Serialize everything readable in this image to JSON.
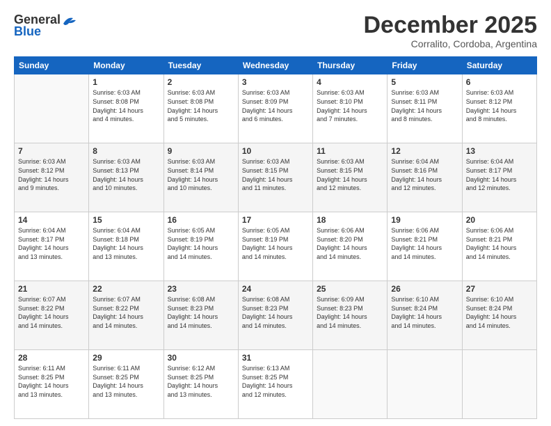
{
  "header": {
    "logo_general": "General",
    "logo_blue": "Blue",
    "month": "December 2025",
    "location": "Corralito, Cordoba, Argentina"
  },
  "weekdays": [
    "Sunday",
    "Monday",
    "Tuesday",
    "Wednesday",
    "Thursday",
    "Friday",
    "Saturday"
  ],
  "weeks": [
    [
      {
        "day": "",
        "sunrise": "",
        "sunset": "",
        "daylight": ""
      },
      {
        "day": "1",
        "sunrise": "Sunrise: 6:03 AM",
        "sunset": "Sunset: 8:08 PM",
        "daylight": "Daylight: 14 hours and 4 minutes."
      },
      {
        "day": "2",
        "sunrise": "Sunrise: 6:03 AM",
        "sunset": "Sunset: 8:08 PM",
        "daylight": "Daylight: 14 hours and 5 minutes."
      },
      {
        "day": "3",
        "sunrise": "Sunrise: 6:03 AM",
        "sunset": "Sunset: 8:09 PM",
        "daylight": "Daylight: 14 hours and 6 minutes."
      },
      {
        "day": "4",
        "sunrise": "Sunrise: 6:03 AM",
        "sunset": "Sunset: 8:10 PM",
        "daylight": "Daylight: 14 hours and 7 minutes."
      },
      {
        "day": "5",
        "sunrise": "Sunrise: 6:03 AM",
        "sunset": "Sunset: 8:11 PM",
        "daylight": "Daylight: 14 hours and 8 minutes."
      },
      {
        "day": "6",
        "sunrise": "Sunrise: 6:03 AM",
        "sunset": "Sunset: 8:12 PM",
        "daylight": "Daylight: 14 hours and 8 minutes."
      }
    ],
    [
      {
        "day": "7",
        "sunrise": "Sunrise: 6:03 AM",
        "sunset": "Sunset: 8:12 PM",
        "daylight": "Daylight: 14 hours and 9 minutes."
      },
      {
        "day": "8",
        "sunrise": "Sunrise: 6:03 AM",
        "sunset": "Sunset: 8:13 PM",
        "daylight": "Daylight: 14 hours and 10 minutes."
      },
      {
        "day": "9",
        "sunrise": "Sunrise: 6:03 AM",
        "sunset": "Sunset: 8:14 PM",
        "daylight": "Daylight: 14 hours and 10 minutes."
      },
      {
        "day": "10",
        "sunrise": "Sunrise: 6:03 AM",
        "sunset": "Sunset: 8:15 PM",
        "daylight": "Daylight: 14 hours and 11 minutes."
      },
      {
        "day": "11",
        "sunrise": "Sunrise: 6:03 AM",
        "sunset": "Sunset: 8:15 PM",
        "daylight": "Daylight: 14 hours and 12 minutes."
      },
      {
        "day": "12",
        "sunrise": "Sunrise: 6:04 AM",
        "sunset": "Sunset: 8:16 PM",
        "daylight": "Daylight: 14 hours and 12 minutes."
      },
      {
        "day": "13",
        "sunrise": "Sunrise: 6:04 AM",
        "sunset": "Sunset: 8:17 PM",
        "daylight": "Daylight: 14 hours and 12 minutes."
      }
    ],
    [
      {
        "day": "14",
        "sunrise": "Sunrise: 6:04 AM",
        "sunset": "Sunset: 8:17 PM",
        "daylight": "Daylight: 14 hours and 13 minutes."
      },
      {
        "day": "15",
        "sunrise": "Sunrise: 6:04 AM",
        "sunset": "Sunset: 8:18 PM",
        "daylight": "Daylight: 14 hours and 13 minutes."
      },
      {
        "day": "16",
        "sunrise": "Sunrise: 6:05 AM",
        "sunset": "Sunset: 8:19 PM",
        "daylight": "Daylight: 14 hours and 14 minutes."
      },
      {
        "day": "17",
        "sunrise": "Sunrise: 6:05 AM",
        "sunset": "Sunset: 8:19 PM",
        "daylight": "Daylight: 14 hours and 14 minutes."
      },
      {
        "day": "18",
        "sunrise": "Sunrise: 6:06 AM",
        "sunset": "Sunset: 8:20 PM",
        "daylight": "Daylight: 14 hours and 14 minutes."
      },
      {
        "day": "19",
        "sunrise": "Sunrise: 6:06 AM",
        "sunset": "Sunset: 8:21 PM",
        "daylight": "Daylight: 14 hours and 14 minutes."
      },
      {
        "day": "20",
        "sunrise": "Sunrise: 6:06 AM",
        "sunset": "Sunset: 8:21 PM",
        "daylight": "Daylight: 14 hours and 14 minutes."
      }
    ],
    [
      {
        "day": "21",
        "sunrise": "Sunrise: 6:07 AM",
        "sunset": "Sunset: 8:22 PM",
        "daylight": "Daylight: 14 hours and 14 minutes."
      },
      {
        "day": "22",
        "sunrise": "Sunrise: 6:07 AM",
        "sunset": "Sunset: 8:22 PM",
        "daylight": "Daylight: 14 hours and 14 minutes."
      },
      {
        "day": "23",
        "sunrise": "Sunrise: 6:08 AM",
        "sunset": "Sunset: 8:23 PM",
        "daylight": "Daylight: 14 hours and 14 minutes."
      },
      {
        "day": "24",
        "sunrise": "Sunrise: 6:08 AM",
        "sunset": "Sunset: 8:23 PM",
        "daylight": "Daylight: 14 hours and 14 minutes."
      },
      {
        "day": "25",
        "sunrise": "Sunrise: 6:09 AM",
        "sunset": "Sunset: 8:23 PM",
        "daylight": "Daylight: 14 hours and 14 minutes."
      },
      {
        "day": "26",
        "sunrise": "Sunrise: 6:10 AM",
        "sunset": "Sunset: 8:24 PM",
        "daylight": "Daylight: 14 hours and 14 minutes."
      },
      {
        "day": "27",
        "sunrise": "Sunrise: 6:10 AM",
        "sunset": "Sunset: 8:24 PM",
        "daylight": "Daylight: 14 hours and 14 minutes."
      }
    ],
    [
      {
        "day": "28",
        "sunrise": "Sunrise: 6:11 AM",
        "sunset": "Sunset: 8:25 PM",
        "daylight": "Daylight: 14 hours and 13 minutes."
      },
      {
        "day": "29",
        "sunrise": "Sunrise: 6:11 AM",
        "sunset": "Sunset: 8:25 PM",
        "daylight": "Daylight: 14 hours and 13 minutes."
      },
      {
        "day": "30",
        "sunrise": "Sunrise: 6:12 AM",
        "sunset": "Sunset: 8:25 PM",
        "daylight": "Daylight: 14 hours and 13 minutes."
      },
      {
        "day": "31",
        "sunrise": "Sunrise: 6:13 AM",
        "sunset": "Sunset: 8:25 PM",
        "daylight": "Daylight: 14 hours and 12 minutes."
      },
      {
        "day": "",
        "sunrise": "",
        "sunset": "",
        "daylight": ""
      },
      {
        "day": "",
        "sunrise": "",
        "sunset": "",
        "daylight": ""
      },
      {
        "day": "",
        "sunrise": "",
        "sunset": "",
        "daylight": ""
      }
    ]
  ]
}
